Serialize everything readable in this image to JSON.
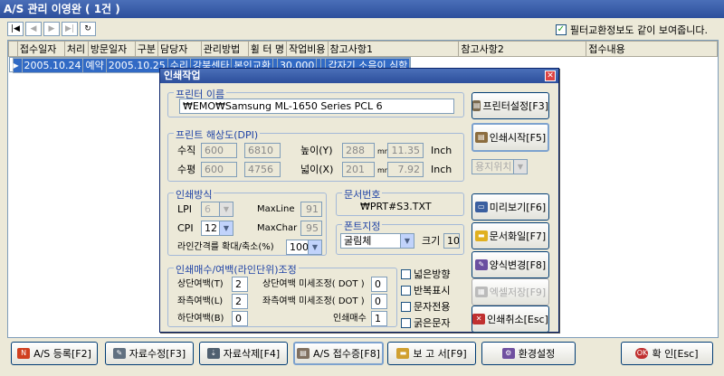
{
  "window": {
    "title": "A/S 관리 이영완 ( 1건 )"
  },
  "nav": {
    "first": "|◀",
    "prev": "◀",
    "next": "▶",
    "last": "▶|",
    "refresh": "↻"
  },
  "filter": {
    "label": "필터교환정보도 같이 보여줍니다.",
    "checked": true
  },
  "grid": {
    "headers": [
      "접수일자",
      "처리",
      "방문일자",
      "구분",
      "담당자",
      "관리방법",
      "휠 터 명",
      "작업비용",
      "참고사항1",
      "참고사항2",
      "접수내용"
    ],
    "row": [
      "2005.10.24",
      "예약",
      "2005.10.25",
      "수리",
      "강북센타",
      "본인교환",
      "",
      "30,000",
      "",
      "",
      "갑자기 소음이 심함"
    ]
  },
  "dialog": {
    "title": "인쇄작업",
    "printer_group": "프린터 이름",
    "printer_name": "₩EMO₩Samsung ML-1650 Series PCL 6",
    "resolution_group": "프린트 해상도(DPI)",
    "vertical_label": "수직",
    "horizontal_label": "수평",
    "v_dpi1": "600",
    "v_dpi2": "6810",
    "h_dpi1": "600",
    "h_dpi2": "4756",
    "height_label": "높이(Y)",
    "width_label": "넓이(X)",
    "height_mm": "288",
    "height_inch": "11.35",
    "width_mm": "201",
    "width_inch": "7.92",
    "mm_unit": "mm",
    "inch_unit": "Inch",
    "paper_select": "용지위치",
    "method_group": "인쇄방식",
    "lpi_label": "LPI",
    "lpi_value": "6",
    "cpi_label": "CPI",
    "cpi_value": "12",
    "maxline_label": "MaxLine",
    "maxline_value": "91",
    "maxchar_label": "MaxChar",
    "maxchar_value": "95",
    "scale_label": "라인간격를 확대/축소(%)",
    "scale_value": "100",
    "docno_group": "문서번호",
    "docno_value": "₩PRT#S3.TXT",
    "font_group": "폰트지정",
    "font_value": "굴림체",
    "size_label": "크기",
    "size_value": "10",
    "margin_group": "인쇄매수/여백(라인단위)조정",
    "top_label": "상단여백(T)",
    "top_value": "2",
    "left_label": "좌측여백(L)",
    "left_value": "2",
    "bottom_label": "하단여백(B)",
    "bottom_value": "0",
    "top_adj_label": "상단여백 미세조정( DOT )",
    "top_adj_value": "0",
    "left_adj_label": "좌측여백 미세조정( DOT )",
    "left_adj_value": "0",
    "copies_label": "인쇄매수",
    "copies_value": "1",
    "opt_landscape": "넓은방향",
    "opt_repeat": "반복표시",
    "opt_text": "문자전용",
    "opt_bold": "굵은문자",
    "btn_printer": "프린터설정[F3]",
    "btn_print": "인쇄시작[F5]",
    "btn_preview": "미리보기[F6]",
    "btn_file": "문서화일[F7]",
    "btn_form": "양식변경[F8]",
    "btn_excel": "엑셀저장[F9]",
    "btn_cancel": "인쇄취소[Esc]"
  },
  "bottom": {
    "register": "A/S 등록[F2]",
    "edit": "자료수정[F3]",
    "delete": "자료삭제[F4]",
    "receipt": "A/S 접수증[F8]",
    "report": "보 고 서[F9]",
    "settings": "환경설정",
    "ok": "확 인[Esc]"
  },
  "colors": {
    "title_bar": "#2d4f9c",
    "selection": "#316ac5",
    "group_label": "#1f43a6"
  }
}
